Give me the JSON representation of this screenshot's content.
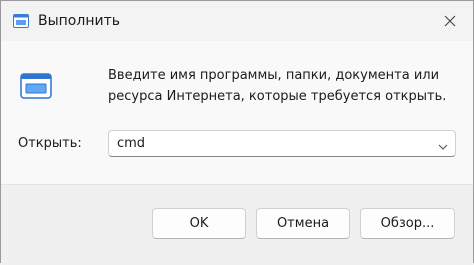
{
  "window": {
    "title": "Выполнить",
    "title_icon": "run-icon",
    "close_icon": "close-icon"
  },
  "content": {
    "icon": "run-dialog-icon",
    "description_line1": "Введите имя программы, папки, документа или",
    "description_line2": "ресурса Интернета, которые требуется открыть.",
    "open_label": "Открыть:",
    "open_value": "cmd"
  },
  "buttons": {
    "ok": "OK",
    "cancel": "Отмена",
    "browse": "Обзор..."
  },
  "colors": {
    "accent": "#0067c0",
    "footer_bg": "#f0f0f0",
    "content_bg": "#f9f9f9"
  }
}
